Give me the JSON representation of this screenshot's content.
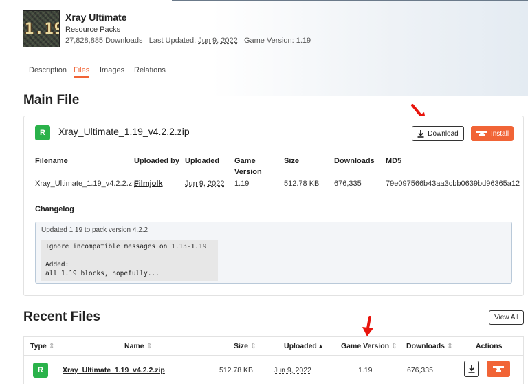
{
  "project": {
    "title": "Xray Ultimate",
    "category": "Resource Packs",
    "downloads_text": "27,828,885 Downloads",
    "last_updated_label": "Last Updated:",
    "last_updated": "Jun 9, 2022",
    "game_version_label": "Game Version: 1.19",
    "logo_text": "1.19"
  },
  "tabs": [
    "Description",
    "Files",
    "Images",
    "Relations"
  ],
  "main_file": {
    "section_title": "Main File",
    "release_badge": "R",
    "file_name": "Xray_Ultimate_1.19_v4.2.2.zip",
    "download_label": "Download",
    "install_label": "Install",
    "headers": {
      "filename": "Filename",
      "uploaded_by": "Uploaded by",
      "uploaded": "Uploaded",
      "game_version_1": "Game",
      "game_version_2": "Version",
      "size": "Size",
      "downloads": "Downloads",
      "md5": "MD5"
    },
    "values": {
      "filename": "Xray_Ultimate_1.19_v4.2.2.zip",
      "uploaded_by": "Filmjolk",
      "uploaded": "Jun 9, 2022",
      "game_version": "1.19",
      "size": "512.78 KB",
      "downloads": "676,335",
      "md5": "79e097566b43aa3cbb0639bd96365a12"
    },
    "changelog_label": "Changelog",
    "changelog_heading": "Updated 1.19 to pack version 4.2.2",
    "changelog_lines": [
      "Ignore incompatible messages on 1.13-1.19",
      "",
      "Added:",
      "all 1.19 blocks, hopefully..."
    ]
  },
  "recent_files": {
    "section_title": "Recent Files",
    "view_all_label": "View All",
    "headers": {
      "type": "Type",
      "name": "Name",
      "size": "Size",
      "uploaded": "Uploaded",
      "game_version": "Game Version",
      "downloads": "Downloads",
      "actions": "Actions"
    },
    "sort_icons": {
      "neutral": "⇕",
      "active": "▴"
    },
    "rows": [
      {
        "type": "R",
        "name": "Xray_Ultimate_1.19_v4.2.2.zip",
        "size": "512.78 KB",
        "uploaded": "Jun 9, 2022",
        "game_version": "1.19",
        "downloads": "676,335"
      }
    ]
  },
  "colors": {
    "accent": "#f16436",
    "release_green": "#2ab24a",
    "annotation_red": "#e8140c"
  }
}
